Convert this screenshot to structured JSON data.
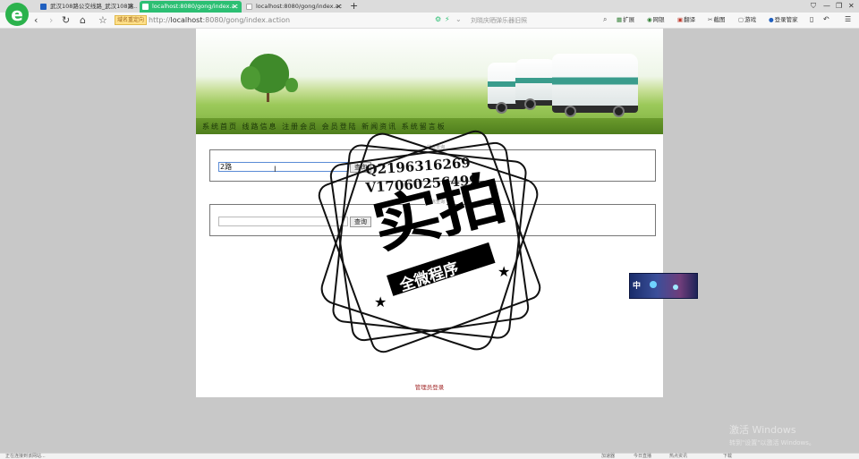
{
  "browser": {
    "tabs": [
      {
        "title": "武汉108路公交线路_武汉108路...",
        "favicon_color": "#1f5fbf",
        "active": false
      },
      {
        "title": "localhost:8080/gong/index.ac",
        "favicon_color": "#ffffff",
        "active": true
      },
      {
        "title": "localhost:8080/gong/index.ac",
        "favicon_color": "#cccccc",
        "active": false
      }
    ],
    "new_tab": "+",
    "logo": "e",
    "badge": "域名重定向",
    "url_prefix": "http://",
    "url_host": "localhost",
    "url_rest": ":8080/gong/index.action",
    "search_placeholder": "刘晓庆晒弹乐器旧照",
    "toolbar_items": [
      "扩展",
      "网银",
      "翻译",
      "截图",
      "游戏",
      "登录管家"
    ]
  },
  "site": {
    "nav_text": "系统首页 线路信息 注册会员 会员登陆 新闻资讯 系统留言板",
    "search1": {
      "legend": "站点查询",
      "value": "2路",
      "button": "查询"
    },
    "search2": {
      "legend": "站点查询",
      "value": "",
      "button": "查询"
    },
    "admin_link": "管理员登录"
  },
  "overlay": {
    "qq": "Q2196316269",
    "vx": "V17060256499",
    "big": "实拍",
    "sub": "全微程序"
  },
  "ad": {
    "text": "中"
  },
  "watermark": {
    "line1": "激活 Windows",
    "line2": "转到\"设置\"以激活 Windows。"
  },
  "status": {
    "left": "正在连接到该网站...",
    "right": [
      "加速器",
      "今日直播",
      "热点资讯",
      "下载"
    ]
  },
  "colors": {
    "active_tab": "#2cbf73",
    "banner_bar": "#5c8a24",
    "admin_link": "#a32c2c"
  }
}
